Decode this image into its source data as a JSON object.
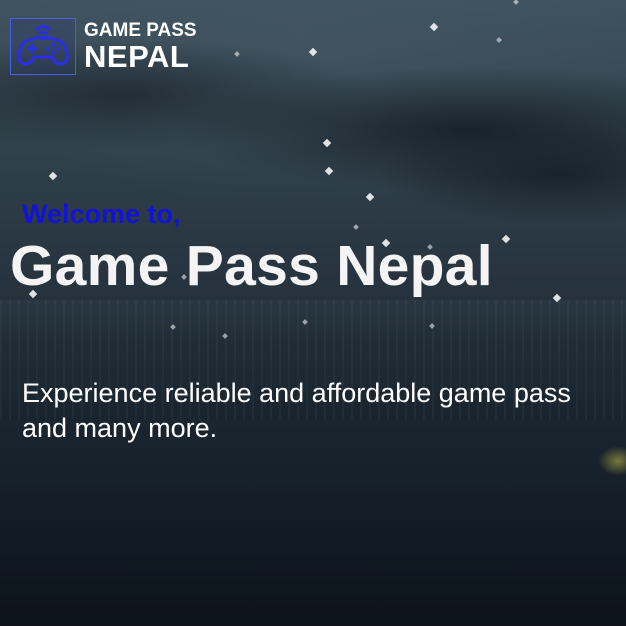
{
  "brand": {
    "logo_icon": "gamepad-icon",
    "line1": "GAME PASS",
    "line2": "NEPAL",
    "accent_color": "#2a2ee8"
  },
  "hero": {
    "welcome": "Welcome to,",
    "title": "Game Pass Nepal",
    "tagline_line1": "Experience reliable and affordable game pass",
    "tagline_line2": "and many more."
  }
}
